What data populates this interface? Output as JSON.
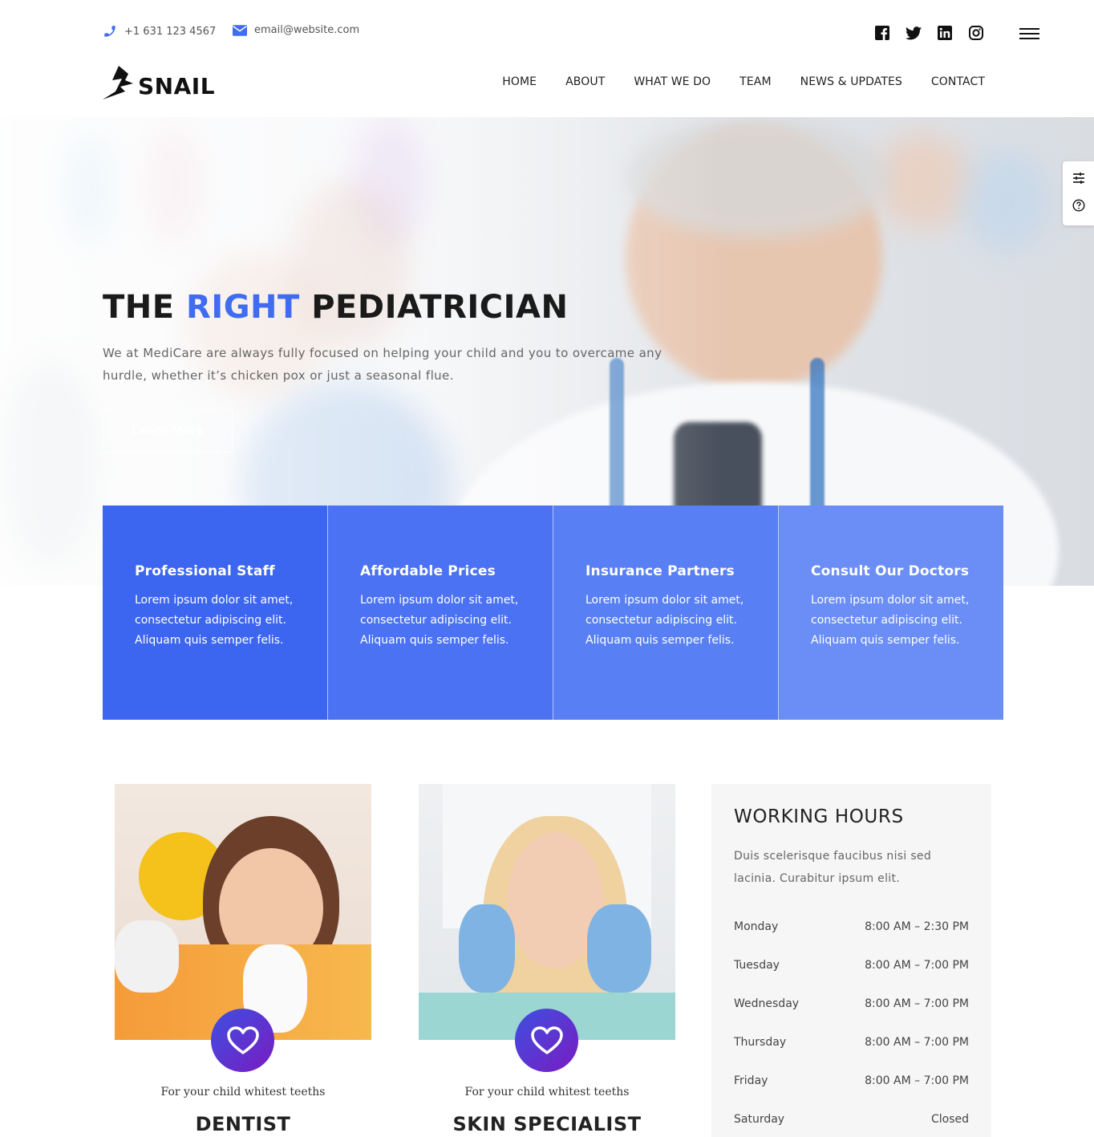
{
  "topbar": {
    "phone": "+1 631 123 4567",
    "email": "email@website.com",
    "social_icons": [
      "facebook-icon",
      "twitter-icon",
      "linkedin-icon",
      "instagram-icon"
    ]
  },
  "brand": {
    "name": "SNAIL"
  },
  "nav": {
    "items": [
      {
        "label": "HOME"
      },
      {
        "label": "ABOUT"
      },
      {
        "label": "WHAT WE DO"
      },
      {
        "label": "TEAM"
      },
      {
        "label": "NEWS & UPDATES"
      },
      {
        "label": "CONTACT"
      }
    ]
  },
  "hero": {
    "title_prefix": "THE ",
    "title_accent": "RIGHT",
    "title_suffix": " PEDIATRICIAN",
    "text": "We at MediCare are always fully focused on helping your child and you to overcame any hurdle, whether it’s chicken pox or just a seasonal flue.",
    "button": "Learn More"
  },
  "features": [
    {
      "title": "Professional Staff",
      "text": "Lorem ipsum dolor sit amet, consectetur adipiscing elit. Aliquam quis semper felis.",
      "color": "#3c66f0"
    },
    {
      "title": "Affordable Prices",
      "text": "Lorem ipsum dolor sit amet, consectetur adipiscing elit. Aliquam quis semper felis.",
      "color": "#4a72f2"
    },
    {
      "title": "Insurance Partners",
      "text": "Lorem ipsum dolor sit amet, consectetur adipiscing elit. Aliquam quis semper felis.",
      "color": "#5880f4"
    },
    {
      "title": "Consult Our Doctors",
      "text": "Lorem ipsum dolor sit amet, consectetur adipiscing elit. Aliquam quis semper felis.",
      "color": "#6a8ef6"
    }
  ],
  "services": [
    {
      "subtitle": "For your child whitest teeths",
      "title": "DENTIST"
    },
    {
      "subtitle": "For your child whitest teeths",
      "title": "SKIN SPECIALIST"
    }
  ],
  "hours": {
    "title": "WORKING HOURS",
    "description": "Duis scelerisque faucibus nisi sed lacinia. Curabitur ipsum elit.",
    "rows": [
      {
        "day": "Monday",
        "time": "8:00 AM – 2:30 PM"
      },
      {
        "day": "Tuesday",
        "time": "8:00 AM – 7:00 PM"
      },
      {
        "day": "Wednesday",
        "time": "8:00 AM – 7:00 PM"
      },
      {
        "day": "Thursday",
        "time": "8:00 AM – 7:00 PM"
      },
      {
        "day": "Friday",
        "time": "8:00 AM – 7:00 PM"
      },
      {
        "day": "Saturday",
        "time": "Closed"
      }
    ]
  },
  "colors": {
    "accent": "#3f6cf0",
    "badge_gradient_start": "#3d50e0",
    "badge_gradient_end": "#7a1bc2"
  }
}
